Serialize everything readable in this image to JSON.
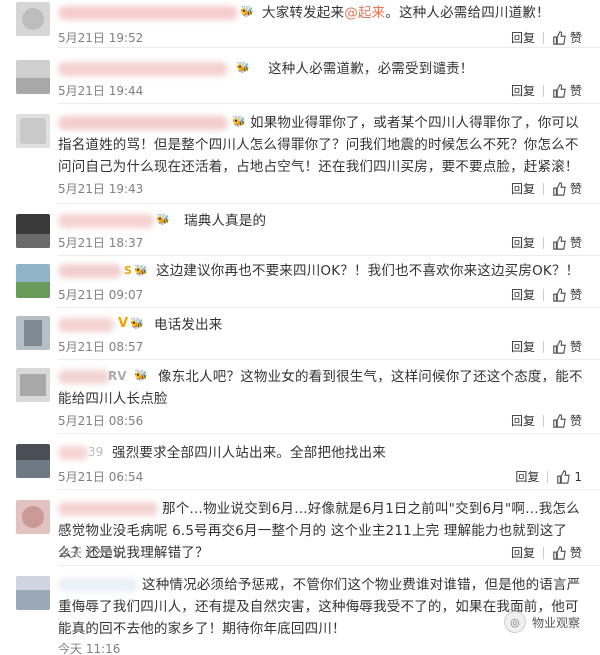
{
  "reply_label": "回复",
  "like_label": "赞",
  "comments": [
    {
      "badge": "",
      "text": "大家转发起来",
      "mention": "@起来",
      "text_after": "。这种人必需给四川道歉！",
      "time": "5月21日 19:52",
      "likes": ""
    },
    {
      "badge": "",
      "text": "这种人必需道歉，必需受到谴责！",
      "time": "5月21日 19:44",
      "likes": ""
    },
    {
      "badge": "",
      "text": "如果物业得罪你了，或者某个四川人得罪你了，你可以指名道姓的骂！但是整个四川人怎么得罪你了？问我们地震的时候怎么不死？你怎么不问问自己为什么现在还活着，占地占空气！还在我们四川买房，要不要点脸，赶紧滚！",
      "time": "5月21日 19:43",
      "likes": ""
    },
    {
      "badge": "",
      "text": "瑞典人真是的",
      "time": "5月21日 18:37",
      "likes": ""
    },
    {
      "badge": "S",
      "text": "这边建议你再也不要来四川OK？！我们也不喜欢你来这边买房OK？！",
      "time": "5月21日 09:07",
      "likes": ""
    },
    {
      "badge": "V",
      "text": "电话发出来",
      "time": "5月21日 08:57",
      "likes": ""
    },
    {
      "badge": "RV",
      "text": "像东北人吧？这物业女的看到很生气，这样问候你了还这个态度，能不能给四川人长点脸",
      "time": "5月21日 08:56",
      "likes": ""
    },
    {
      "badge": "39",
      "text": "强烈要求全部四川人站出来。全部把他找出来",
      "time": "5月21日 06:54",
      "likes": "1"
    },
    {
      "badge": "",
      "text": "那个…物业说交到6月…好像就是6月1日之前叫\"交到6月\"啊…我怎么感觉物业没毛病呢 6.5号再交6月一整个月的 这个业主211上完 理解能力也就到这了么？还是说我理解错了？",
      "time": "今天 12:05",
      "likes": ""
    },
    {
      "badge": "",
      "text": "这种情况必须给予惩戒，不管你们这个物业费谁对谁错，但是他的语言严重侮辱了我们四川人，还有提及自然灾害，这种侮辱我受不了的，如果在我面前，他可能真的回不去他的家乡了！期待你年底回四川！",
      "time": "今天 11:16",
      "likes": ""
    }
  ],
  "watermark": "物业观察",
  "colors": {
    "accent": "#eb7350",
    "badge_red": "#e6162d",
    "muted": "#808080"
  }
}
